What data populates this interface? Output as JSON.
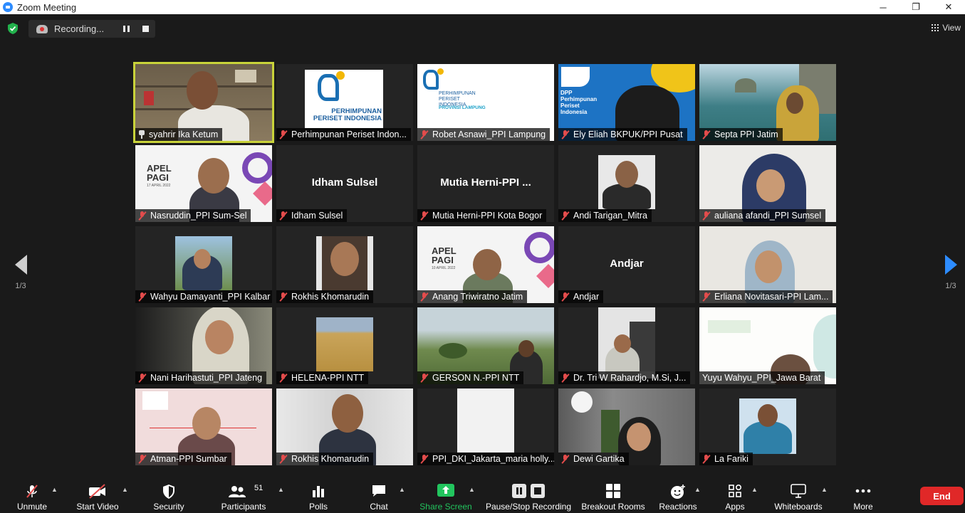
{
  "window": {
    "title": "Zoom Meeting",
    "controls": [
      "─",
      "❐",
      "✕"
    ]
  },
  "recording": {
    "label": "Recording..."
  },
  "view": {
    "label": "View"
  },
  "pager": {
    "left": "1/3",
    "right": "1/3"
  },
  "tiles": [
    {
      "label": "syahrir Ika Ketum",
      "pinned": true
    },
    {
      "label": "Perhimpunan Periset Indon...",
      "logo_text": "PERHIMPUNAN PERISET INDONESIA"
    },
    {
      "label": "Robet Asnawi_PPI Lampung",
      "logo_text": "PERHIMPUNAN PERISET INDONESIA",
      "logo_sub": "PROVINSI LAMPUNG"
    },
    {
      "label": "Ely Eliah BKPUK/PPI Pusat",
      "banner_text": "DPP Perhimpunan Periset Indonesia"
    },
    {
      "label": "Septa PPI Jatim"
    },
    {
      "label": "Nasruddin_PPI Sum-Sel",
      "banner_title": "APEL PAGI",
      "banner_date": "17 APRIL 2022"
    },
    {
      "label": "Idham Sulsel",
      "big_name": "Idham Sulsel"
    },
    {
      "label": "Mutia Herni-PPI Kota Bogor",
      "big_name": "Mutia  Herni-PPI ..."
    },
    {
      "label": "Andi Tarigan_Mitra"
    },
    {
      "label": "auliana afandi_PPI Sumsel"
    },
    {
      "label": "Wahyu Damayanti_PPI Kalbar"
    },
    {
      "label": "Rokhis Khomarudin"
    },
    {
      "label": "Anang Triwiratno Jatim",
      "banner_title": "APEL PAGI",
      "banner_date": "10 APRIL 2022"
    },
    {
      "label": "Andjar",
      "big_name": "Andjar"
    },
    {
      "label": "Erliana Novitasari-PPI Lam..."
    },
    {
      "label": "Nani Harihastuti_PPI Jateng"
    },
    {
      "label": "HELENA-PPI NTT"
    },
    {
      "label": "GERSON N.-PPI NTT"
    },
    {
      "label": "Dr. Tri W Rahardjo, M.Si, J..."
    },
    {
      "label": "Yuyu Wahyu_PPI_Jawa Barat"
    },
    {
      "label": "Atman-PPI Sumbar"
    },
    {
      "label": "Rokhis Khomarudin"
    },
    {
      "label": "PPI_DKI_Jakarta_maria holly..."
    },
    {
      "label": "Dewi Gartika"
    },
    {
      "label": "La Fariki"
    }
  ],
  "toolbar": {
    "unmute": "Unmute",
    "start_video": "Start Video",
    "security": "Security",
    "participants": "Participants",
    "participants_count": "51",
    "polls": "Polls",
    "chat": "Chat",
    "share_screen": "Share Screen",
    "pause_stop": "Pause/Stop Recording",
    "breakout": "Breakout Rooms",
    "reactions": "Reactions",
    "apps": "Apps",
    "whiteboards": "Whiteboards",
    "more": "More",
    "end": "End"
  },
  "colors": {
    "active_speaker": "#c9d33a",
    "share_green": "#22c55e",
    "end_red": "#e02828",
    "accent_blue": "#2d8cff"
  }
}
